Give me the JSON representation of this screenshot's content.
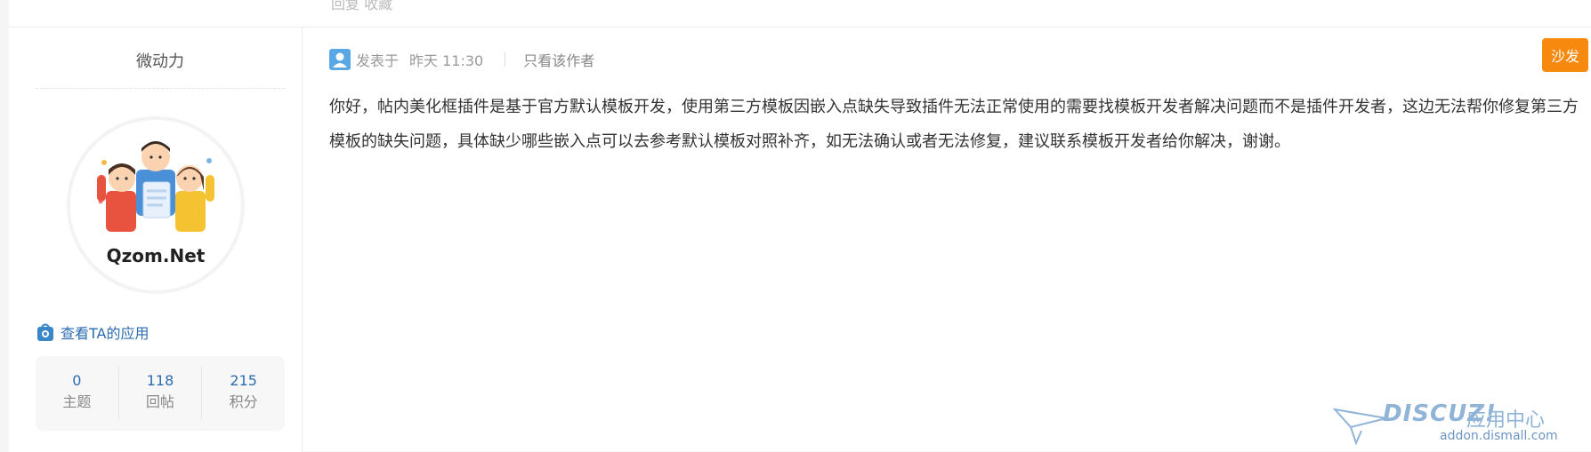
{
  "top": {
    "ghost_text": "回复  收藏"
  },
  "author": {
    "name": "微动力",
    "avatar_text": "Qzom.Net",
    "apps_link": "查看TA的应用",
    "stats": [
      {
        "value": "0",
        "label": "主题"
      },
      {
        "value": "118",
        "label": "回帖"
      },
      {
        "value": "215",
        "label": "积分"
      }
    ]
  },
  "post": {
    "posted_label": "发表于",
    "time": "昨天 11:30",
    "only_author": "只看该作者",
    "floor": "沙发",
    "content": "你好，帖内美化框插件是基于官方默认模板开发，使用第三方模板因嵌入点缺失导致插件无法正常使用的需要找模板开发者解决问题而不是插件开发者，这边无法帮你修复第三方模板的缺失问题，具体缺少哪些嵌入点可以去参考默认模板对照补齐，如无法确认或者无法修复，建议联系模板开发者给你解决，谢谢。"
  },
  "watermark": {
    "brand": "DISCUZ!",
    "subtitle": "应用中心",
    "url": "addon.dismall.com"
  },
  "colors": {
    "accent": "#f7890f",
    "link": "#2b6cb0",
    "watermark": "#8fb4d8"
  }
}
